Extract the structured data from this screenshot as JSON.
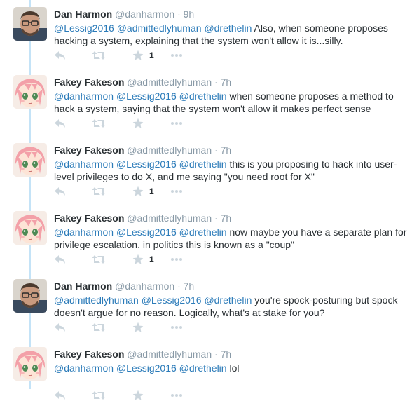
{
  "thread": [
    {
      "author": "Dan Harmon",
      "handle": "@danharmon",
      "separator": "·",
      "time": "9h",
      "avatar": "dan",
      "segments": [
        {
          "type": "mention",
          "text": "@Lessig2016"
        },
        {
          "type": "text",
          "text": " "
        },
        {
          "type": "mention",
          "text": "@admittedlyhuman"
        },
        {
          "type": "text",
          "text": " "
        },
        {
          "type": "mention",
          "text": "@drethelin"
        },
        {
          "type": "text",
          "text": " Also, when someone proposes hacking a system, explaining that the system won't allow it is...silly."
        }
      ],
      "favorite_count": "1"
    },
    {
      "author": "Fakey Fakeson",
      "handle": "@admittedlyhuman",
      "separator": "·",
      "time": "7h",
      "avatar": "fakey",
      "segments": [
        {
          "type": "mention",
          "text": "@danharmon"
        },
        {
          "type": "text",
          "text": " "
        },
        {
          "type": "mention",
          "text": "@Lessig2016"
        },
        {
          "type": "text",
          "text": " "
        },
        {
          "type": "mention",
          "text": "@drethelin"
        },
        {
          "type": "text",
          "text": " when someone proposes a method to hack a system, saying that the system won't allow it makes perfect sense"
        }
      ],
      "favorite_count": ""
    },
    {
      "author": "Fakey Fakeson",
      "handle": "@admittedlyhuman",
      "separator": "·",
      "time": "7h",
      "avatar": "fakey",
      "segments": [
        {
          "type": "mention",
          "text": "@danharmon"
        },
        {
          "type": "text",
          "text": " "
        },
        {
          "type": "mention",
          "text": "@Lessig2016"
        },
        {
          "type": "text",
          "text": " "
        },
        {
          "type": "mention",
          "text": "@drethelin"
        },
        {
          "type": "text",
          "text": " this is you proposing to hack into user-level privileges to do X, and me saying \"you need root for X\""
        }
      ],
      "favorite_count": "1"
    },
    {
      "author": "Fakey Fakeson",
      "handle": "@admittedlyhuman",
      "separator": "·",
      "time": "7h",
      "avatar": "fakey",
      "segments": [
        {
          "type": "mention",
          "text": "@danharmon"
        },
        {
          "type": "text",
          "text": " "
        },
        {
          "type": "mention",
          "text": "@Lessig2016"
        },
        {
          "type": "text",
          "text": " "
        },
        {
          "type": "mention",
          "text": "@drethelin"
        },
        {
          "type": "text",
          "text": " now maybe you have a separate plan for privilege escalation. in politics this is known as a \"coup\""
        }
      ],
      "favorite_count": "1"
    },
    {
      "author": "Dan Harmon",
      "handle": "@danharmon",
      "separator": "·",
      "time": "7h",
      "avatar": "dan",
      "segments": [
        {
          "type": "mention",
          "text": "@admittedlyhuman"
        },
        {
          "type": "text",
          "text": " "
        },
        {
          "type": "mention",
          "text": "@Lessig2016"
        },
        {
          "type": "text",
          "text": " "
        },
        {
          "type": "mention",
          "text": "@drethelin"
        },
        {
          "type": "text",
          "text": " you're spock-posturing but spock doesn't argue for no reason. Logically, what's at stake for you?"
        }
      ],
      "favorite_count": ""
    },
    {
      "author": "Fakey Fakeson",
      "handle": "@admittedlyhuman",
      "separator": "·",
      "time": "7h",
      "avatar": "fakey",
      "segments": [
        {
          "type": "mention",
          "text": "@danharmon"
        },
        {
          "type": "text",
          "text": " "
        },
        {
          "type": "mention",
          "text": "@Lessig2016"
        },
        {
          "type": "text",
          "text": " "
        },
        {
          "type": "mention",
          "text": "@drethelin"
        },
        {
          "type": "text",
          "text": " lol"
        }
      ],
      "favorite_count": ""
    }
  ],
  "action_icons": [
    "reply-icon",
    "retweet-icon",
    "favorite-icon",
    "more-icon"
  ],
  "colors": {
    "mention": "#2b7bb9",
    "text": "#292f33",
    "meta": "#8899a6",
    "icon": "#ccd6dd",
    "thread_line": "#c4e3f7"
  }
}
